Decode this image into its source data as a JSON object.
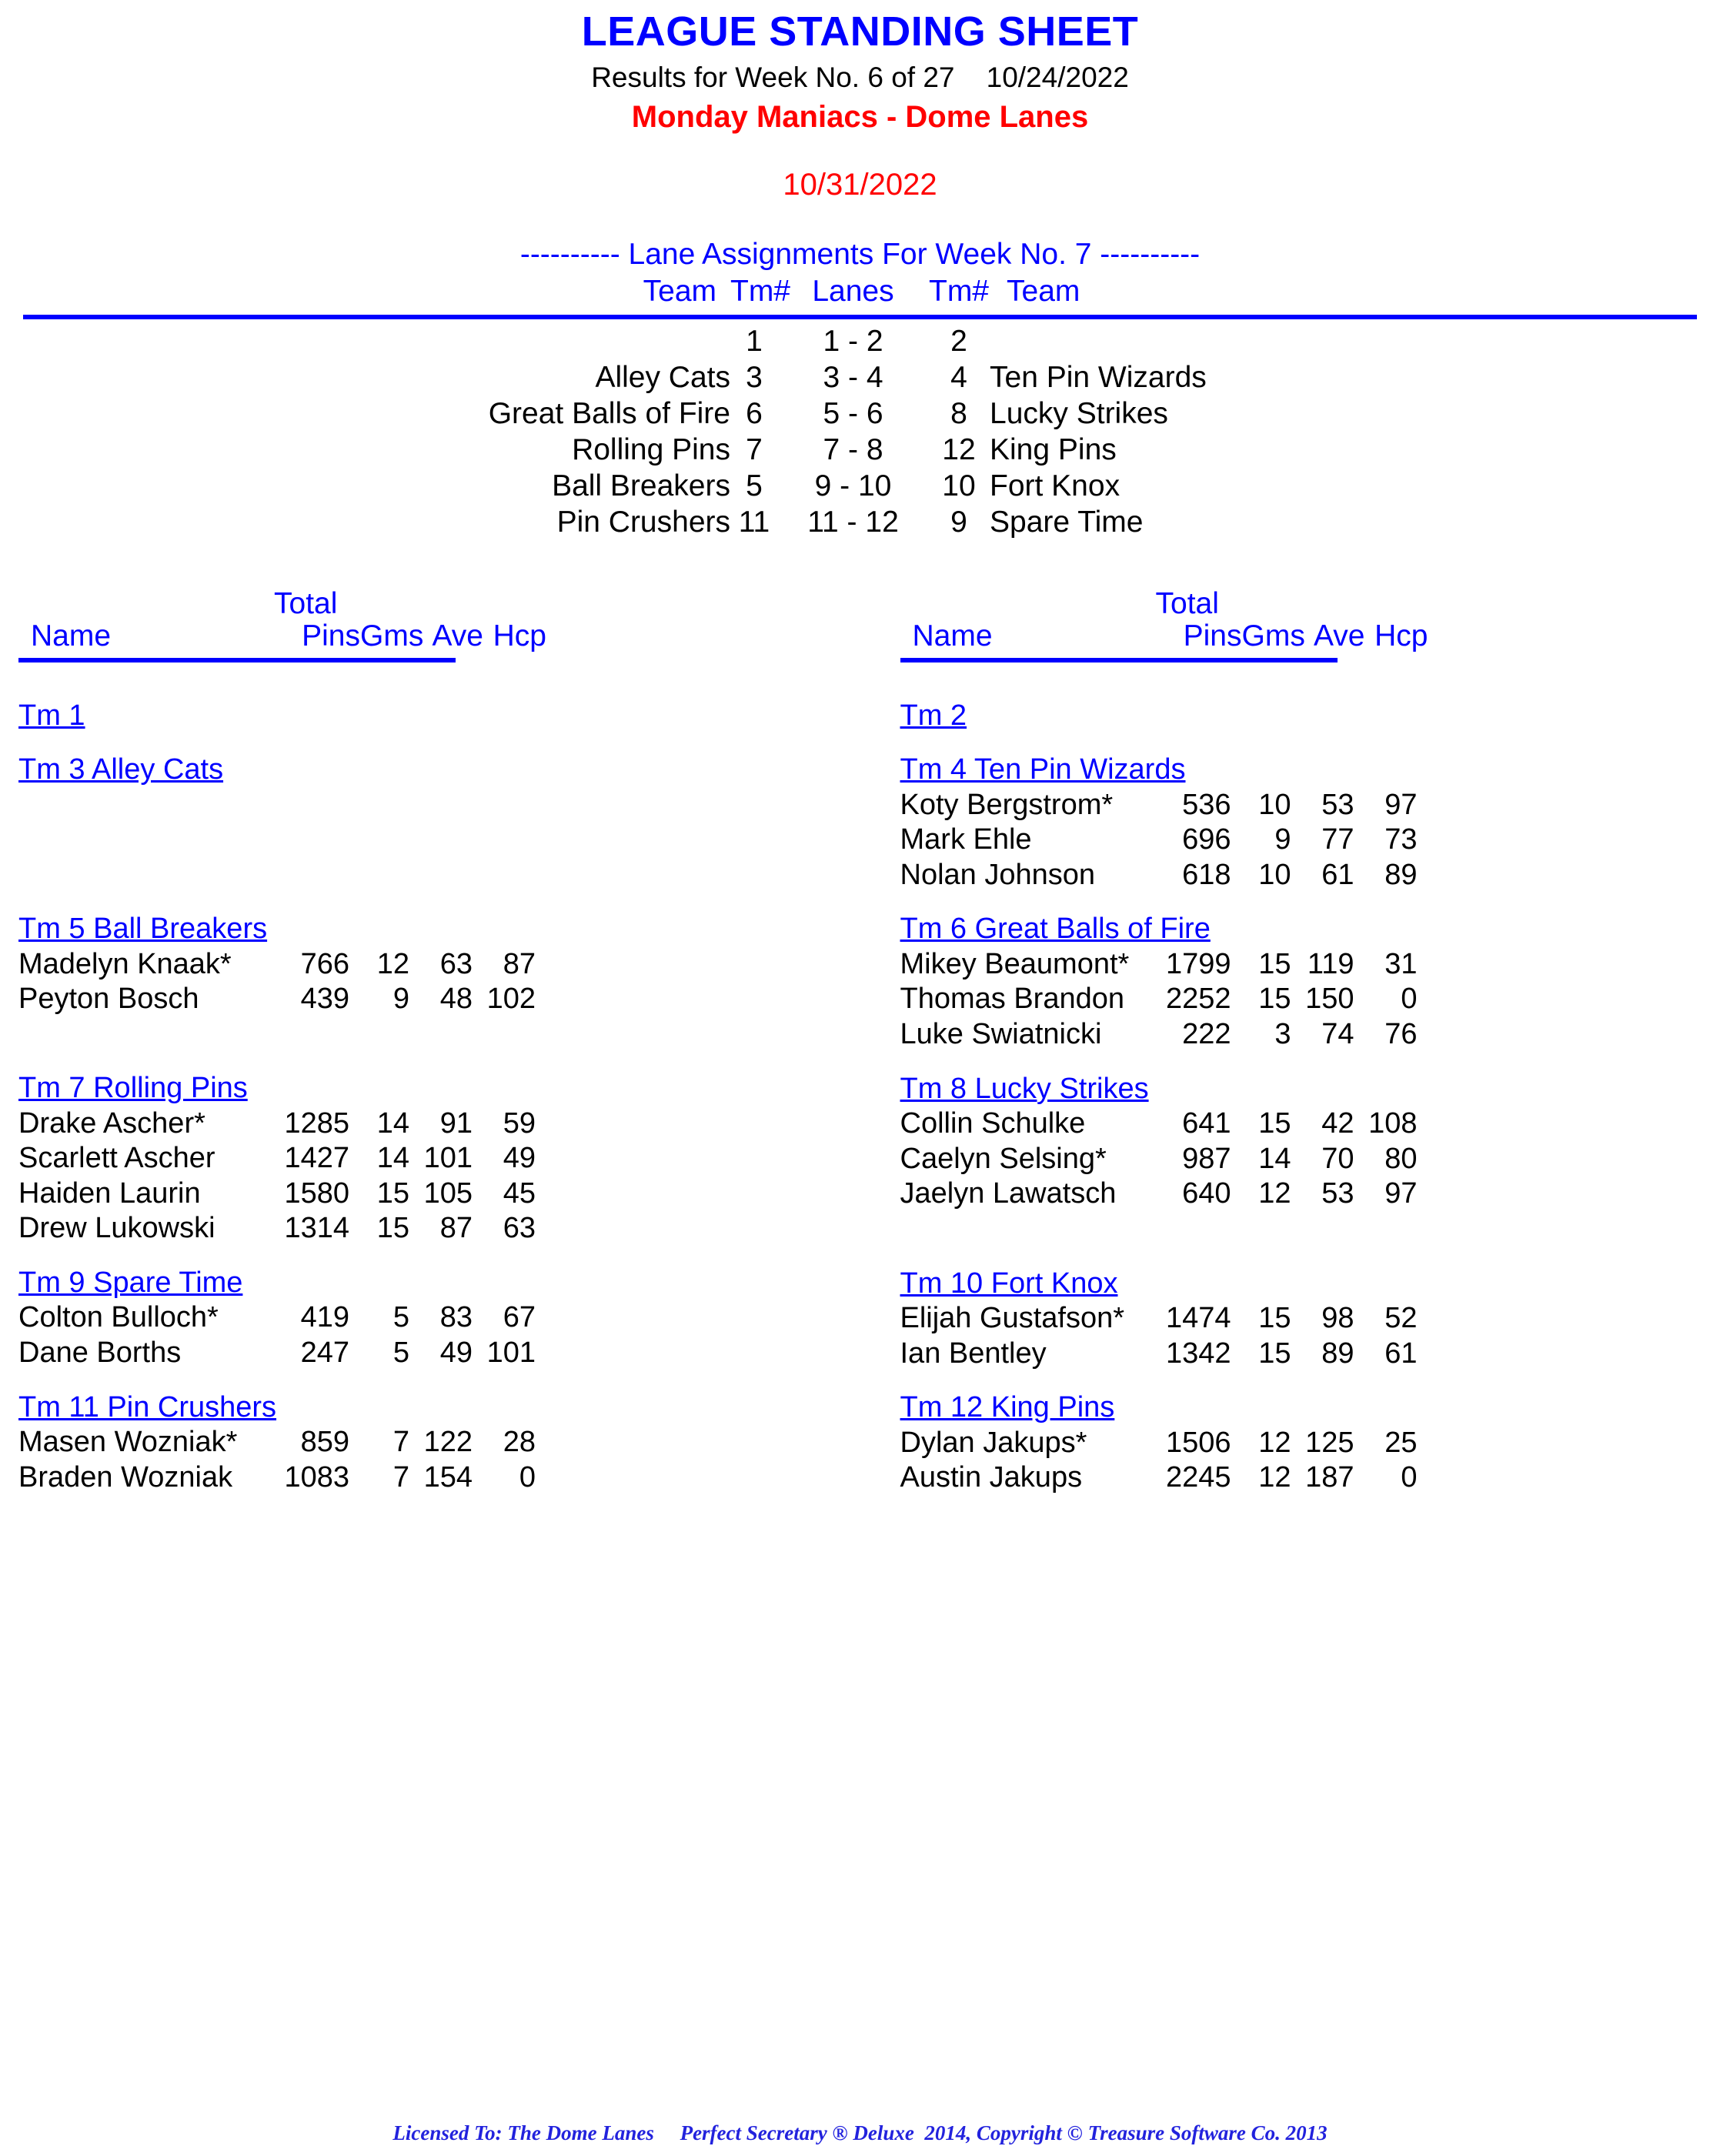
{
  "header": {
    "title": "LEAGUE STANDING SHEET",
    "results_line": "Results for Week No. 6 of 27    10/24/2022",
    "league": "Monday Maniacs - Dome Lanes",
    "print_date": "10/31/2022",
    "title_color": "#0000ff",
    "league_color": "#ff0000",
    "date_color": "#ff0000"
  },
  "lane_assignments": {
    "title": "---------- Lane Assignments For Week No. 7 ----------",
    "columns": [
      "Team",
      "Tm#",
      "Lanes",
      "Tm#",
      "Team"
    ],
    "rows": [
      {
        "team_left": "",
        "tm_left": "1",
        "lanes": "1 -  2",
        "tm_right": "2",
        "team_right": ""
      },
      {
        "team_left": "Alley Cats",
        "tm_left": "3",
        "lanes": "3 -  4",
        "tm_right": "4",
        "team_right": "Ten Pin Wizards"
      },
      {
        "team_left": "Great Balls of Fire",
        "tm_left": "6",
        "lanes": "5 -  6",
        "tm_right": "8",
        "team_right": "Lucky Strikes"
      },
      {
        "team_left": "Rolling Pins",
        "tm_left": "7",
        "lanes": "7 -  8",
        "tm_right": "12",
        "team_right": "King Pins"
      },
      {
        "team_left": "Ball Breakers",
        "tm_left": "5",
        "lanes": "9 - 10",
        "tm_right": "10",
        "team_right": "Fort Knox"
      },
      {
        "team_left": "Pin Crushers",
        "tm_left": "11",
        "lanes": "11 - 12",
        "tm_right": "9",
        "team_right": "Spare Time"
      }
    ]
  },
  "roster_headers": {
    "name": "Name",
    "total": "Total",
    "pins": "Pins",
    "gms": "Gms",
    "ave": "Ave",
    "hcp": "Hcp"
  },
  "left_column": {
    "teams": [
      {
        "title": "Tm 1",
        "players": []
      },
      {
        "title": "Tm 3 Alley Cats",
        "players": []
      },
      {
        "title": "Tm 5 Ball Breakers",
        "players": [
          {
            "name": "Madelyn Knaak*",
            "pins": "766",
            "gms": "12",
            "ave": "63",
            "hcp": "87"
          },
          {
            "name": "Peyton Bosch",
            "pins": "439",
            "gms": "9",
            "ave": "48",
            "hcp": "102"
          }
        ]
      },
      {
        "title": "Tm 7 Rolling Pins",
        "players": [
          {
            "name": "Drake Ascher*",
            "pins": "1285",
            "gms": "14",
            "ave": "91",
            "hcp": "59"
          },
          {
            "name": "Scarlett Ascher",
            "pins": "1427",
            "gms": "14",
            "ave": "101",
            "hcp": "49"
          },
          {
            "name": "Haiden Laurin",
            "pins": "1580",
            "gms": "15",
            "ave": "105",
            "hcp": "45"
          },
          {
            "name": "Drew Lukowski",
            "pins": "1314",
            "gms": "15",
            "ave": "87",
            "hcp": "63"
          }
        ]
      },
      {
        "title": "Tm 9 Spare Time",
        "players": [
          {
            "name": "Colton Bulloch*",
            "pins": "419",
            "gms": "5",
            "ave": "83",
            "hcp": "67"
          },
          {
            "name": "Dane Borths",
            "pins": "247",
            "gms": "5",
            "ave": "49",
            "hcp": "101"
          }
        ]
      },
      {
        "title": "Tm 11 Pin Crushers",
        "players": [
          {
            "name": "Masen Wozniak*",
            "pins": "859",
            "gms": "7",
            "ave": "122",
            "hcp": "28"
          },
          {
            "name": "Braden Wozniak",
            "pins": "1083",
            "gms": "7",
            "ave": "154",
            "hcp": "0"
          }
        ]
      }
    ]
  },
  "right_column": {
    "teams": [
      {
        "title": "Tm 2",
        "players": []
      },
      {
        "title": "Tm 4 Ten Pin Wizards",
        "players": [
          {
            "name": "Koty Bergstrom*",
            "pins": "536",
            "gms": "10",
            "ave": "53",
            "hcp": "97"
          },
          {
            "name": "Mark Ehle",
            "pins": "696",
            "gms": "9",
            "ave": "77",
            "hcp": "73"
          },
          {
            "name": "Nolan Johnson",
            "pins": "618",
            "gms": "10",
            "ave": "61",
            "hcp": "89"
          }
        ]
      },
      {
        "title": "Tm 6 Great Balls of Fire",
        "players": [
          {
            "name": "Mikey Beaumont*",
            "pins": "1799",
            "gms": "15",
            "ave": "119",
            "hcp": "31"
          },
          {
            "name": "Thomas Brandon",
            "pins": "2252",
            "gms": "15",
            "ave": "150",
            "hcp": "0"
          },
          {
            "name": "Luke Swiatnicki",
            "pins": "222",
            "gms": "3",
            "ave": "74",
            "hcp": "76"
          }
        ]
      },
      {
        "title": "Tm 8 Lucky Strikes",
        "players": [
          {
            "name": "Collin Schulke",
            "pins": "641",
            "gms": "15",
            "ave": "42",
            "hcp": "108"
          },
          {
            "name": "Caelyn Selsing*",
            "pins": "987",
            "gms": "14",
            "ave": "70",
            "hcp": "80"
          },
          {
            "name": "Jaelyn Lawatsch",
            "pins": "640",
            "gms": "12",
            "ave": "53",
            "hcp": "97"
          }
        ]
      },
      {
        "title": "Tm 10 Fort Knox",
        "players": [
          {
            "name": "Elijah Gustafson*",
            "pins": "1474",
            "gms": "15",
            "ave": "98",
            "hcp": "52"
          },
          {
            "name": "Ian Bentley",
            "pins": "1342",
            "gms": "15",
            "ave": "89",
            "hcp": "61"
          }
        ]
      },
      {
        "title": "Tm 12 King Pins",
        "players": [
          {
            "name": "Dylan Jakups*",
            "pins": "1506",
            "gms": "12",
            "ave": "125",
            "hcp": "25"
          },
          {
            "name": "Austin Jakups",
            "pins": "2245",
            "gms": "12",
            "ave": "187",
            "hcp": "0"
          }
        ]
      }
    ]
  },
  "footer": {
    "text": "Licensed To: The Dome Lanes     Perfect Secretary ® Deluxe  2014, Copyright © Treasure Software Co. 2013",
    "color": "#2222dd"
  }
}
